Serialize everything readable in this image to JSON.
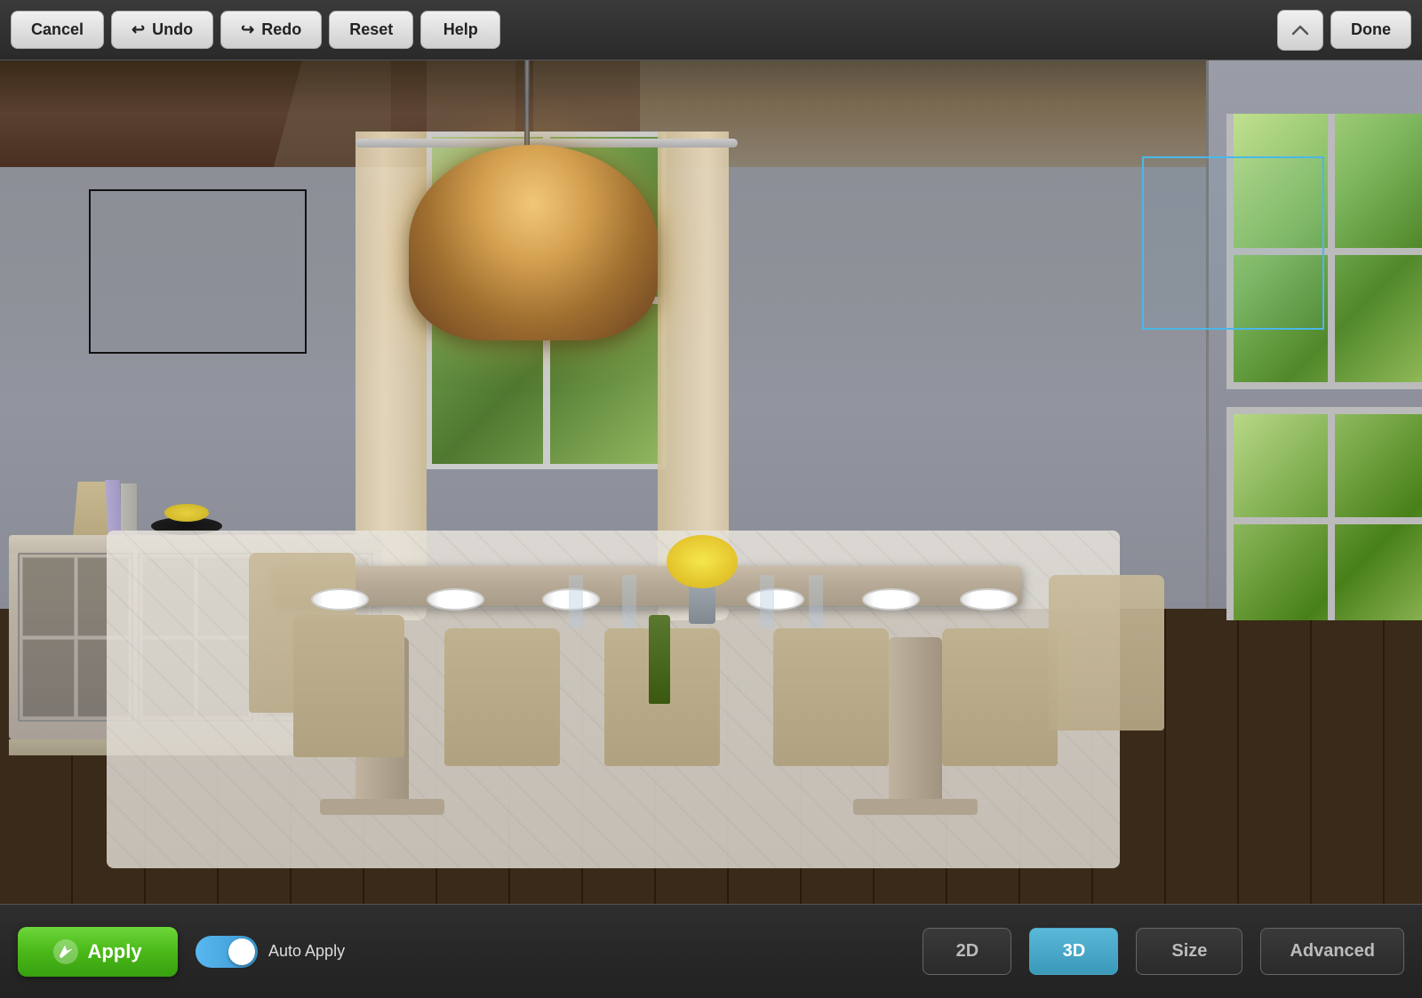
{
  "toolbar": {
    "cancel_label": "Cancel",
    "undo_label": "Undo",
    "redo_label": "Redo",
    "reset_label": "Reset",
    "help_label": "Help",
    "done_label": "Done"
  },
  "bottom_toolbar": {
    "apply_label": "Apply",
    "auto_apply_label": "Auto Apply",
    "btn_2d_label": "2D",
    "btn_3d_label": "3D",
    "size_label": "Size",
    "advanced_label": "Advanced",
    "active_mode": "3D"
  },
  "scene": {
    "selection_box_black": {
      "label": "wall-art-selection"
    },
    "selection_box_blue": {
      "label": "window-selection"
    }
  },
  "icons": {
    "undo": "↩",
    "redo": "↪",
    "apply": "✏"
  }
}
